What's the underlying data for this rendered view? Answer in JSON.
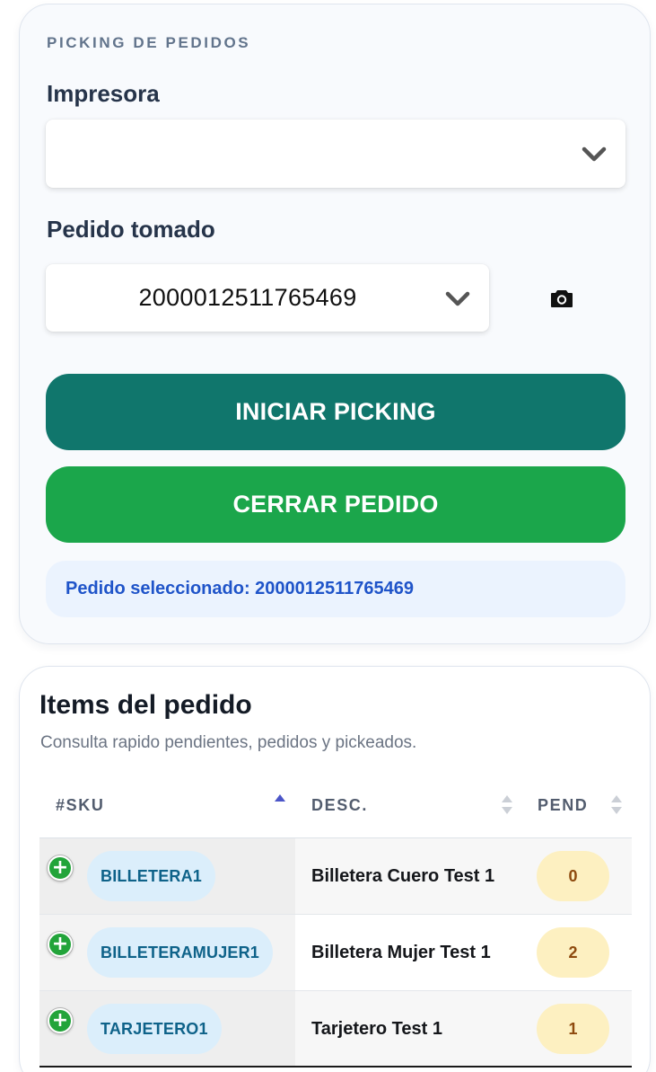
{
  "panel": {
    "eyebrow": "PICKING DE PEDIDOS",
    "printer_label": "Impresora",
    "printer_value": "",
    "order_label": "Pedido tomado",
    "order_value": "2000012511765469",
    "start_button": "INICIAR PICKING",
    "close_button": "CERRAR PEDIDO",
    "selected_info": "Pedido seleccionado: 2000012511765469"
  },
  "items": {
    "title": "Items del pedido",
    "subtitle": "Consulta rapido pendientes, pedidos y pickeados.",
    "columns": [
      "#SKU",
      "DESC.",
      "PEND"
    ],
    "sort_active": "#SKU ascending",
    "rows": [
      {
        "sku": "BILLETERA1",
        "desc": "Billetera Cuero Test 1",
        "pend": "0"
      },
      {
        "sku": "BILLETERAMUJER1",
        "desc": "Billetera Mujer Test 1",
        "pend": "2"
      },
      {
        "sku": "TARJETERO1",
        "desc": "Tarjetero Test 1",
        "pend": "1"
      }
    ]
  },
  "colors": {
    "start_button": "#10766c",
    "close_button": "#1ba64b",
    "info_text": "#1f54c9",
    "sort_active": "#4b55c8"
  },
  "icons": {
    "dropdown": "chevron-down-icon",
    "camera": "camera-icon",
    "sort": "sort-icon",
    "add": "plus-circle-icon"
  }
}
